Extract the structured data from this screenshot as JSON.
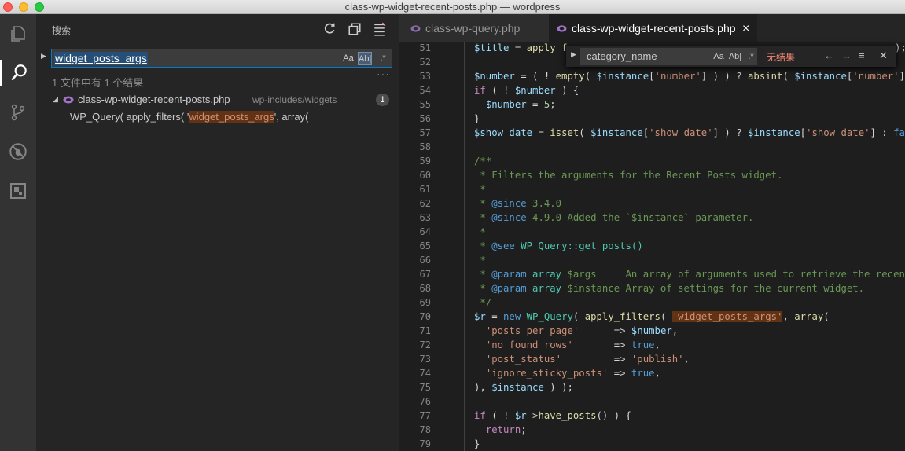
{
  "window": {
    "title": "class-wp-widget-recent-posts.php — wordpress"
  },
  "activity_bar": {
    "items": [
      "explorer-icon",
      "search-icon",
      "source-control-icon",
      "debug-icon",
      "extensions-icon"
    ]
  },
  "sidebar": {
    "title": "搜索",
    "search_value": "widget_posts_args",
    "opt_case": "Aa",
    "opt_word": "Ab|",
    "opt_regex": ".*",
    "more": "···",
    "summary": "1 文件中有 1 个结果",
    "file": {
      "name": "class-wp-widget-recent-posts.php",
      "path": "wp-includes/widgets",
      "count": "1"
    },
    "match": {
      "before": "WP_Query( apply_filters( '",
      "hit": "widget_posts_args",
      "after": "', array("
    }
  },
  "tabs": [
    {
      "label": "class-wp-query.php"
    },
    {
      "label": "class-wp-widget-recent-posts.php",
      "close": "×"
    }
  ],
  "find_widget": {
    "value": "category_name",
    "opt_case": "Aa",
    "opt_word": "Ab|",
    "opt_regex": ".*",
    "status": "无结果"
  },
  "editor": {
    "line_numbers": [
      "51",
      "52",
      "53",
      "54",
      "55",
      "56",
      "57",
      "58",
      "59",
      "60",
      "61",
      "62",
      "63",
      "64",
      "65",
      "66",
      "67",
      "68",
      "69",
      "70",
      "71",
      "72",
      "73",
      "74",
      "75",
      "76",
      "77",
      "78",
      "79"
    ]
  }
}
